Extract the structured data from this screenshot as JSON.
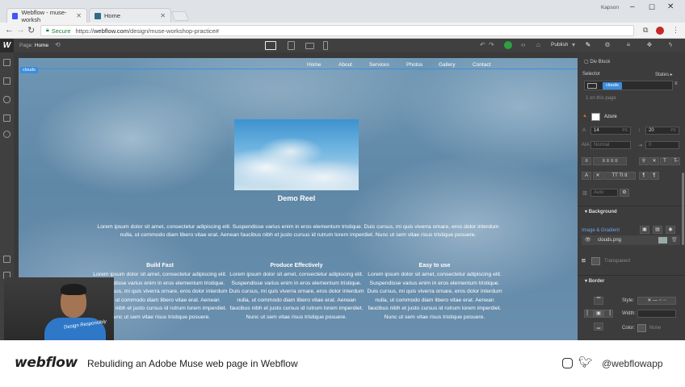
{
  "browser": {
    "tabs": [
      {
        "label": "Webflow - muse-worksh",
        "fav_color": "#4353ff"
      },
      {
        "label": "Home",
        "fav_color": "#2f6b8a"
      }
    ],
    "user": "Kapson",
    "secure_label": "Secure",
    "url_scheme": "https://",
    "url_host": "webflow.com",
    "url_path": "/design/muse-workshop-practice#"
  },
  "designer": {
    "logo": "W",
    "page_label": "Page:",
    "page_name": "Home",
    "publish_label": "Publish",
    "site": {
      "nav": [
        "Home",
        "About",
        "Services",
        "Photos",
        "Gallery",
        "Contact"
      ],
      "selection_tag": "clouds",
      "hero_title": "Demo Reel",
      "intro": "Lorem ipsum dolor sit amet, consectetur adipiscing elit. Suspendisse varius enim in eros elementum tristique. Duis cursus, mi quis viverra ornare, eros dolor interdum nulla, ut commodo diam libero vitae erat. Aenean faucibus nibh et justo cursus id rutrum lorem imperdiet. Nunc ut sem vitae risus tristique posuere.",
      "columns": [
        {
          "title": "Build Fast",
          "text": "Lorem ipsum dolor sit amet, consectetur adipiscing elit. Suspendisse varius enim in eros elementum tristique. Duis cursus, mi quis viverra ornare, eros dolor interdum nulla, ut commodo diam libero vitae erat. Aenean faucibus nibh et justo cursus id rutrum lorem imperdiet. Nunc ut sem vitae risus tristique posuere."
        },
        {
          "title": "Produce Effectively",
          "text": "Lorem ipsum dolor sit amet, consectetur adipiscing elit. Suspendisse varius enim in eros elementum tristique. Duis cursus, mi quis viverra ornare, eros dolor interdum nulla, ut commodo diam libero vitae erat. Aenean faucibus nibh et justo cursus id rutrum lorem imperdiet. Nunc ut sem vitae risus tristique posuere."
        },
        {
          "title": "Easy to use",
          "text": "Lorem ipsum dolor sit amet, consectetur adipiscing elit. Suspendisse varius enim in eros elementum tristique. Duis cursus, mi quis viverra ornare, eros dolor interdum nulla, ut commodo diam libero vitae erat. Aenean faucibus nibh et justo cursus id rutrum lorem imperdiet. Nunc ut sem vitae risus tristique posuere."
        }
      ]
    },
    "style_panel": {
      "element_type": "Div Block",
      "selector_label": "Selector",
      "states_label": "States",
      "selector_class": "clouds",
      "on_page": "1 on this page",
      "font_name": "Azure",
      "font_size": "14",
      "font_size_unit": "PX",
      "line_height": "20",
      "line_height_unit": "PX",
      "letter_spacing": "Normal",
      "text_indent": "0",
      "auto_label": "Auto",
      "background_header": "Background",
      "image_gradient": "Image & Gradient",
      "bg_file": "clouds.png",
      "color_value": "Transparent",
      "border_header": "Border",
      "style_label": "Style:",
      "width_label": "Width:",
      "color_label": "Color:",
      "border_color_value": "None",
      "accent": "#3b8ede"
    }
  },
  "webcam": {
    "shirt_text": "Design Responsibly"
  },
  "caption": {
    "logo": "webflow",
    "title": "Rebuliding an Adobe Muse web page in Webflow",
    "handle": "@webflowapp"
  }
}
